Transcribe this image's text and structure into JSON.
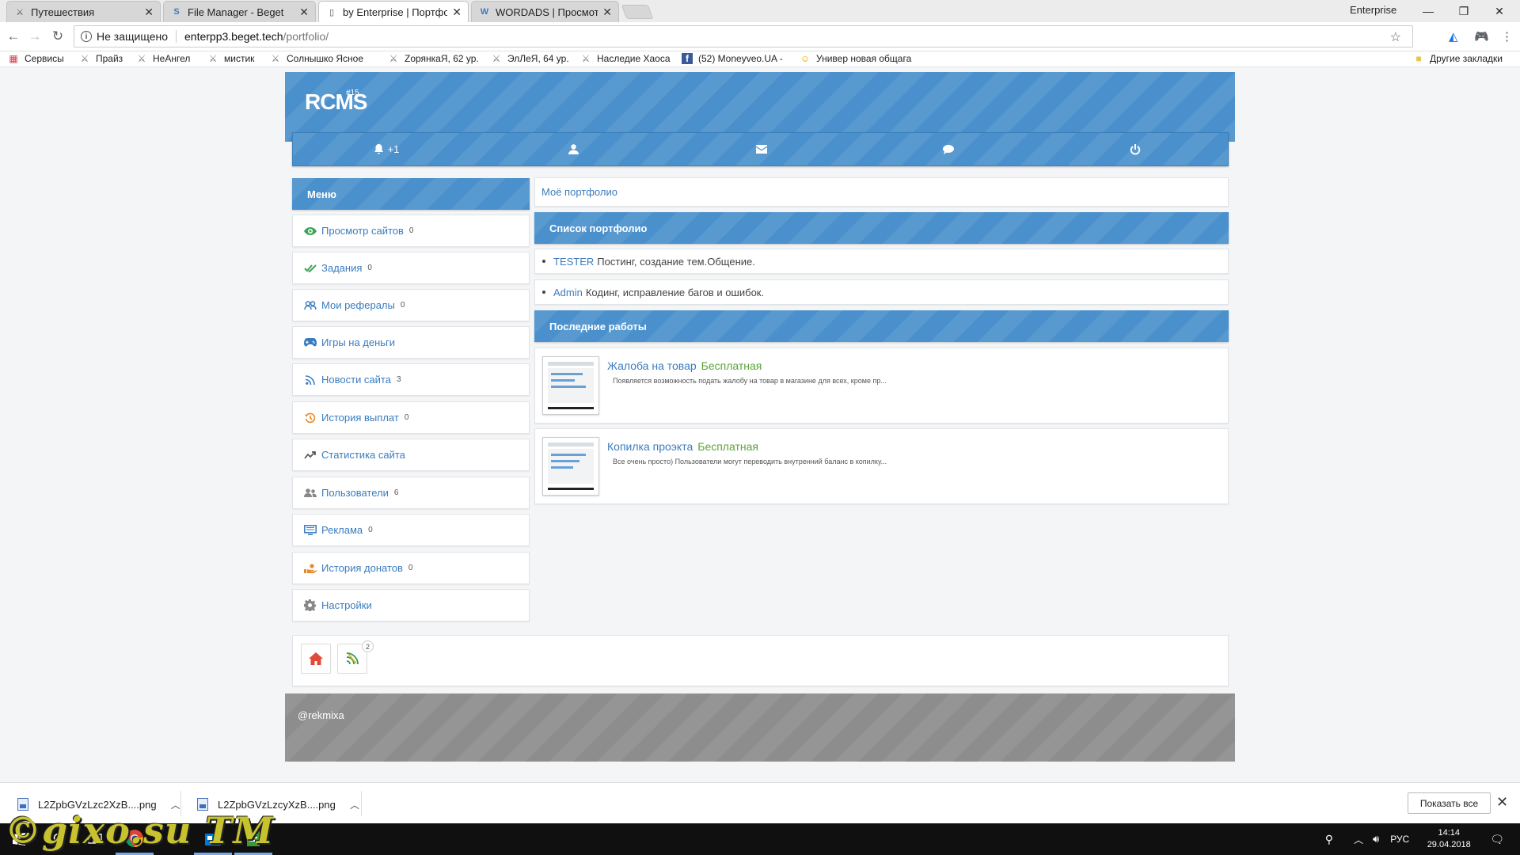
{
  "browser": {
    "tabs": [
      {
        "title": "Путешествия",
        "active": false
      },
      {
        "title": "File Manager - Beget",
        "active": false
      },
      {
        "title": "by Enterprise | Портфолио",
        "active": true
      },
      {
        "title": "WORDADS | Просмотр с",
        "active": false
      }
    ],
    "profile_name": "Enterprise",
    "security_label": "Не защищено",
    "url_host": "enterpp3.beget.tech",
    "url_path": "/portfolio/",
    "bookmarks": [
      "Сервисы",
      "Прайз",
      "НеАнгел",
      "мистик",
      "Солнышко Ясное",
      "ZoрянкаЯ, 62 ур.",
      "ЭлЛеЯ, 64 ур.",
      "Наследие Хаоса",
      "(52) Moneyveo.UA -",
      "Универ новая общага"
    ],
    "other_bookmarks": "Другие закладки"
  },
  "site": {
    "logo": "RCMS",
    "version": "#15",
    "nav": {
      "notifications_badge": "+1"
    },
    "menu_title": "Меню",
    "menu": [
      {
        "label": "Просмотр сайтов",
        "count": "0",
        "icon": "eye-icon",
        "color": "#3aa55a"
      },
      {
        "label": "Задания",
        "count": "0",
        "icon": "check-icon",
        "color": "#3aa55a"
      },
      {
        "label": "Мои рефералы",
        "count": "0",
        "icon": "users-icon",
        "color": "#3a7cbf"
      },
      {
        "label": "Игры на деньги",
        "count": "",
        "icon": "gamepad-icon",
        "color": "#3a7cbf"
      },
      {
        "label": "Новости сайта",
        "count": "3",
        "icon": "rss-icon",
        "color": "#3a7cbf"
      },
      {
        "label": "История выплат",
        "count": "0",
        "icon": "history-icon",
        "color": "#e58a2a"
      },
      {
        "label": "Статистика сайта",
        "count": "",
        "icon": "chart-icon",
        "color": "#555555"
      },
      {
        "label": "Пользователи",
        "count": "6",
        "icon": "group-icon",
        "color": "#777777"
      },
      {
        "label": "Реклама",
        "count": "0",
        "icon": "monitor-icon",
        "color": "#3a7cbf"
      },
      {
        "label": "История донатов",
        "count": "0",
        "icon": "donate-icon",
        "color": "#e58a2a"
      },
      {
        "label": "Настройки",
        "count": "",
        "icon": "gear-icon",
        "color": "#777777"
      }
    ],
    "breadcrumb": "Моё портфолио",
    "portfolio_title": "Список портфолио",
    "portfolio": [
      {
        "name": "TESTER",
        "desc": "Постинг, создание тем.Общение."
      },
      {
        "name": "Admin",
        "desc": "Кодинг, исправление багов и ошибок."
      }
    ],
    "latest_title": "Последние работы",
    "works": [
      {
        "title": "Жалоба на товар",
        "price": "Бесплатная",
        "desc": "Появляется возможность подать жалобу на товар в магазине для всех, кроме пр..."
      },
      {
        "title": "Копилка проэкта",
        "price": "Бесплатная",
        "desc": "Все очень просто) Пользователи могут переводить внутренний баланс в копилку..."
      }
    ],
    "quickbar_badge": "2",
    "footer": "@rekmixa"
  },
  "downloads": {
    "files": [
      "L2ZpbGVzLzc2XzB....png",
      "L2ZpbGVzLzcyXzB....png"
    ],
    "show_all": "Показать все"
  },
  "taskbar": {
    "lang": "РУС",
    "time": "14:14",
    "date": "29.04.2018"
  },
  "watermark": "©gixo.su TM",
  "colors": {
    "accent": "#4a90cc",
    "link": "#3a7cbf",
    "free": "#5aa43a"
  }
}
